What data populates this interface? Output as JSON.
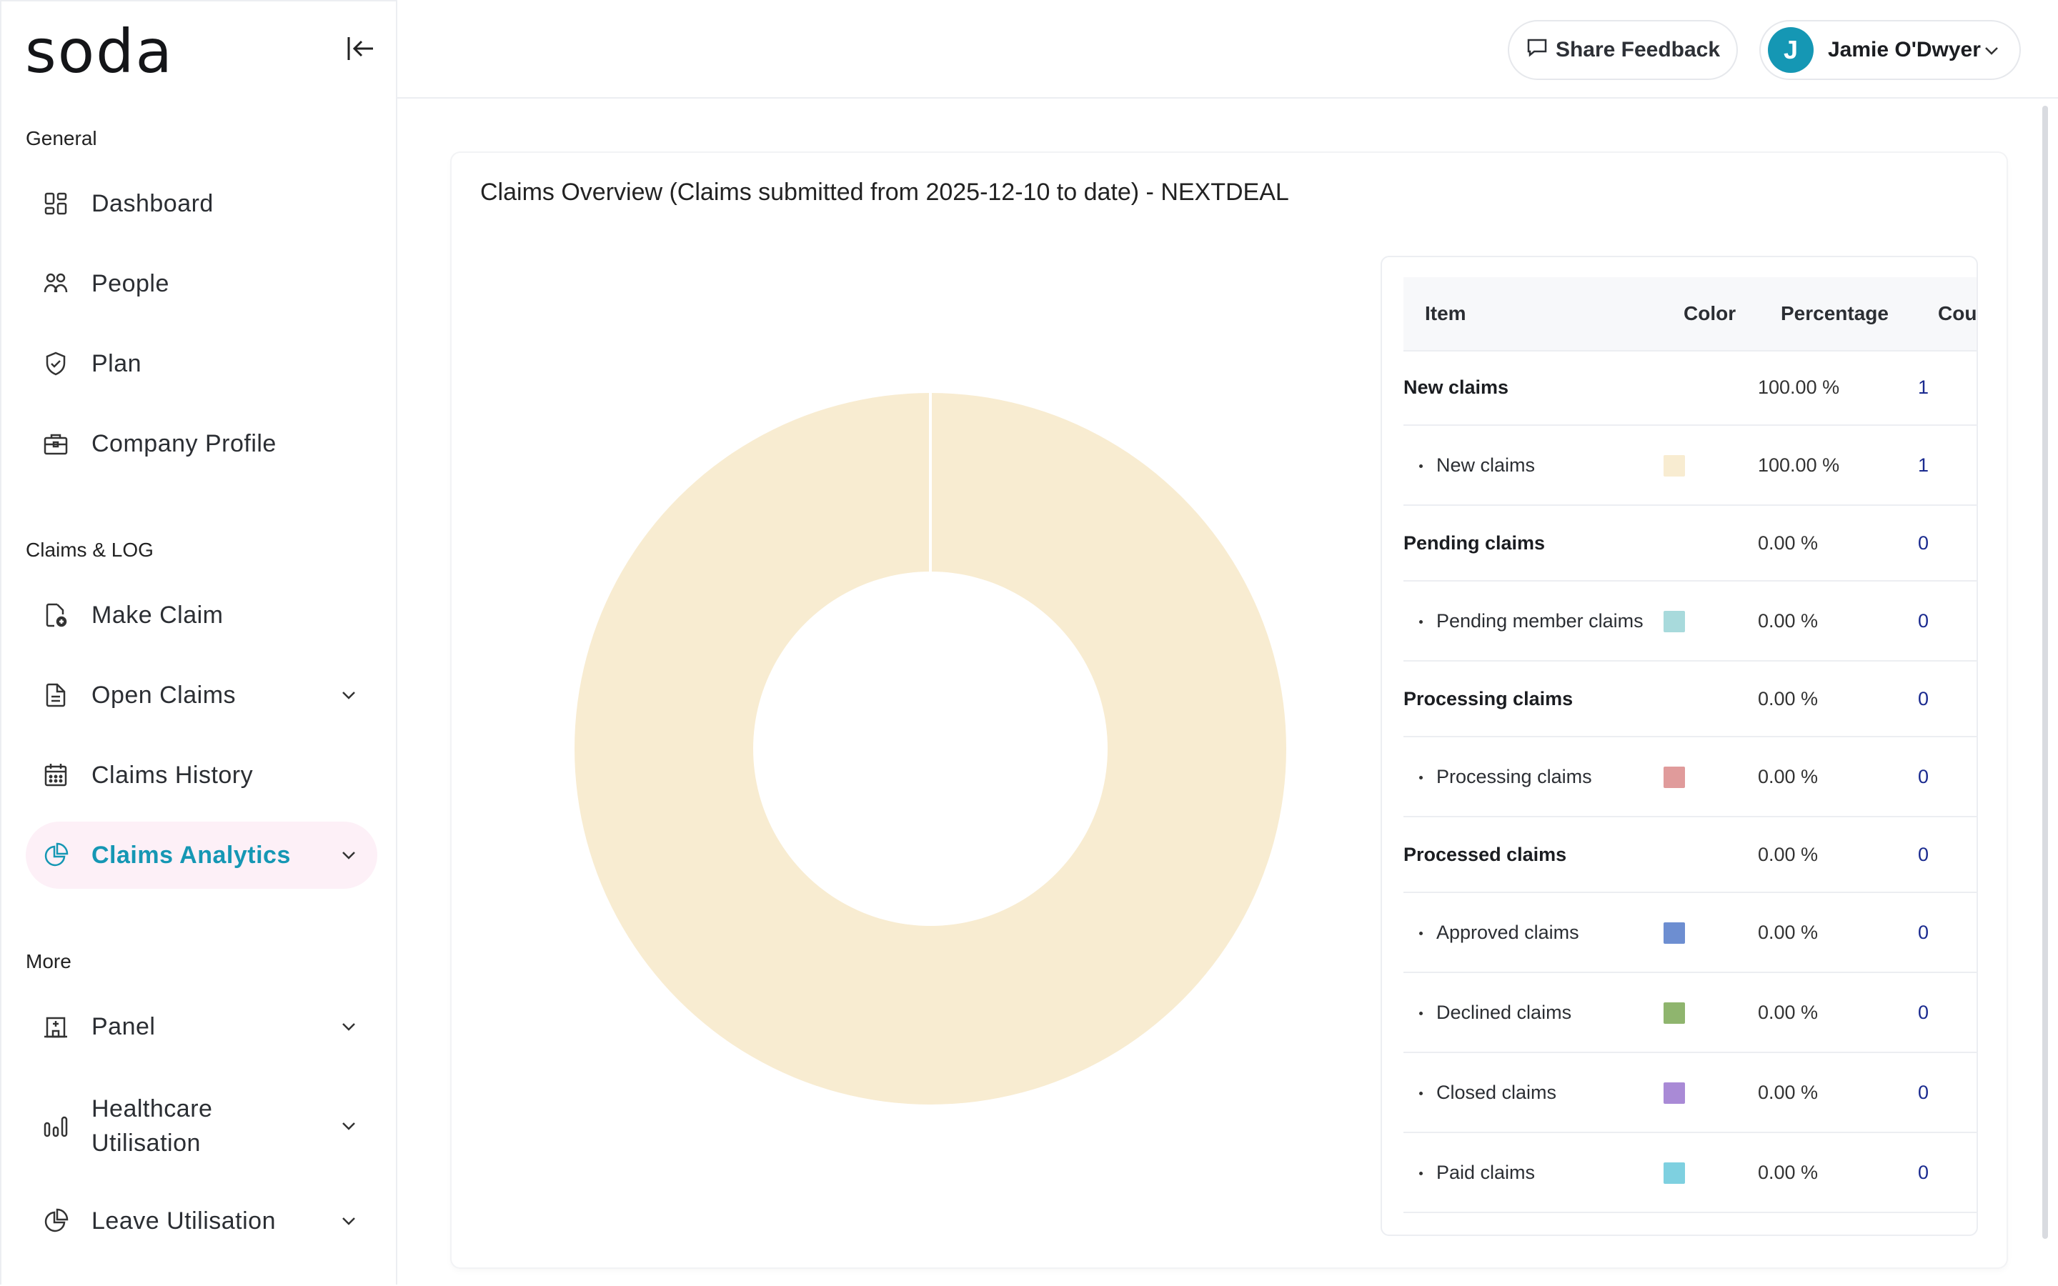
{
  "app": {
    "logo": "soda"
  },
  "sidebar": {
    "sections": [
      {
        "label": "General"
      },
      {
        "label": "Claims & LOG"
      },
      {
        "label": "More"
      }
    ],
    "items": [
      {
        "label": "Dashboard"
      },
      {
        "label": "People"
      },
      {
        "label": "Plan"
      },
      {
        "label": "Company Profile"
      },
      {
        "label": "Make Claim"
      },
      {
        "label": "Open Claims"
      },
      {
        "label": "Claims History"
      },
      {
        "label": "Claims Analytics"
      },
      {
        "label": "Panel"
      },
      {
        "label": "Healthcare",
        "label2": "Utilisation"
      },
      {
        "label": "Leave Utilisation"
      }
    ]
  },
  "header": {
    "feedback_label": "Share Feedback",
    "user_initial": "J",
    "user_name": "Jamie O'Dwyer"
  },
  "card": {
    "title": "Claims Overview (Claims submitted from 2025-12-10 to date) - NEXTDEAL"
  },
  "table": {
    "headers": {
      "item": "Item",
      "color": "Color",
      "percentage": "Percentage",
      "count": "Cou"
    },
    "rows": [
      {
        "type": "group",
        "name": "New claims",
        "pct": "100.00 %",
        "count": "1"
      },
      {
        "type": "sub",
        "name": "New claims",
        "color": "#f8ecd1",
        "pct": "100.00 %",
        "count": "1"
      },
      {
        "type": "group",
        "name": "Pending claims",
        "pct": "0.00 %",
        "count": "0"
      },
      {
        "type": "sub",
        "name": "Pending member claims",
        "color": "#a8dadc",
        "pct": "0.00 %",
        "count": "0"
      },
      {
        "type": "group",
        "name": "Processing claims",
        "pct": "0.00 %",
        "count": "0"
      },
      {
        "type": "sub",
        "name": "Processing claims",
        "color": "#e09b9b",
        "pct": "0.00 %",
        "count": "0"
      },
      {
        "type": "group",
        "name": "Processed claims",
        "pct": "0.00 %",
        "count": "0"
      },
      {
        "type": "sub",
        "name": "Approved claims",
        "color": "#6d8ed1",
        "pct": "0.00 %",
        "count": "0"
      },
      {
        "type": "sub",
        "name": "Declined claims",
        "color": "#8fb56e",
        "pct": "0.00 %",
        "count": "0"
      },
      {
        "type": "sub",
        "name": "Closed claims",
        "color": "#a98ad6",
        "pct": "0.00 %",
        "count": "0"
      },
      {
        "type": "sub",
        "name": "Paid claims",
        "color": "#7ed0e0",
        "pct": "0.00 %",
        "count": "0"
      }
    ]
  },
  "chart_data": {
    "type": "pie",
    "categories": [
      "New claims",
      "Pending member claims",
      "Processing claims",
      "Approved claims",
      "Declined claims",
      "Closed claims",
      "Paid claims"
    ],
    "values": [
      100,
      0,
      0,
      0,
      0,
      0,
      0
    ],
    "colors": [
      "#f8ecd1",
      "#a8dadc",
      "#e09b9b",
      "#6d8ed1",
      "#8fb56e",
      "#a98ad6",
      "#7ed0e0"
    ],
    "donut": true,
    "legend": "table-right"
  },
  "colors": {
    "accent": "#1597b4",
    "active_bg": "#fdf0f7"
  }
}
